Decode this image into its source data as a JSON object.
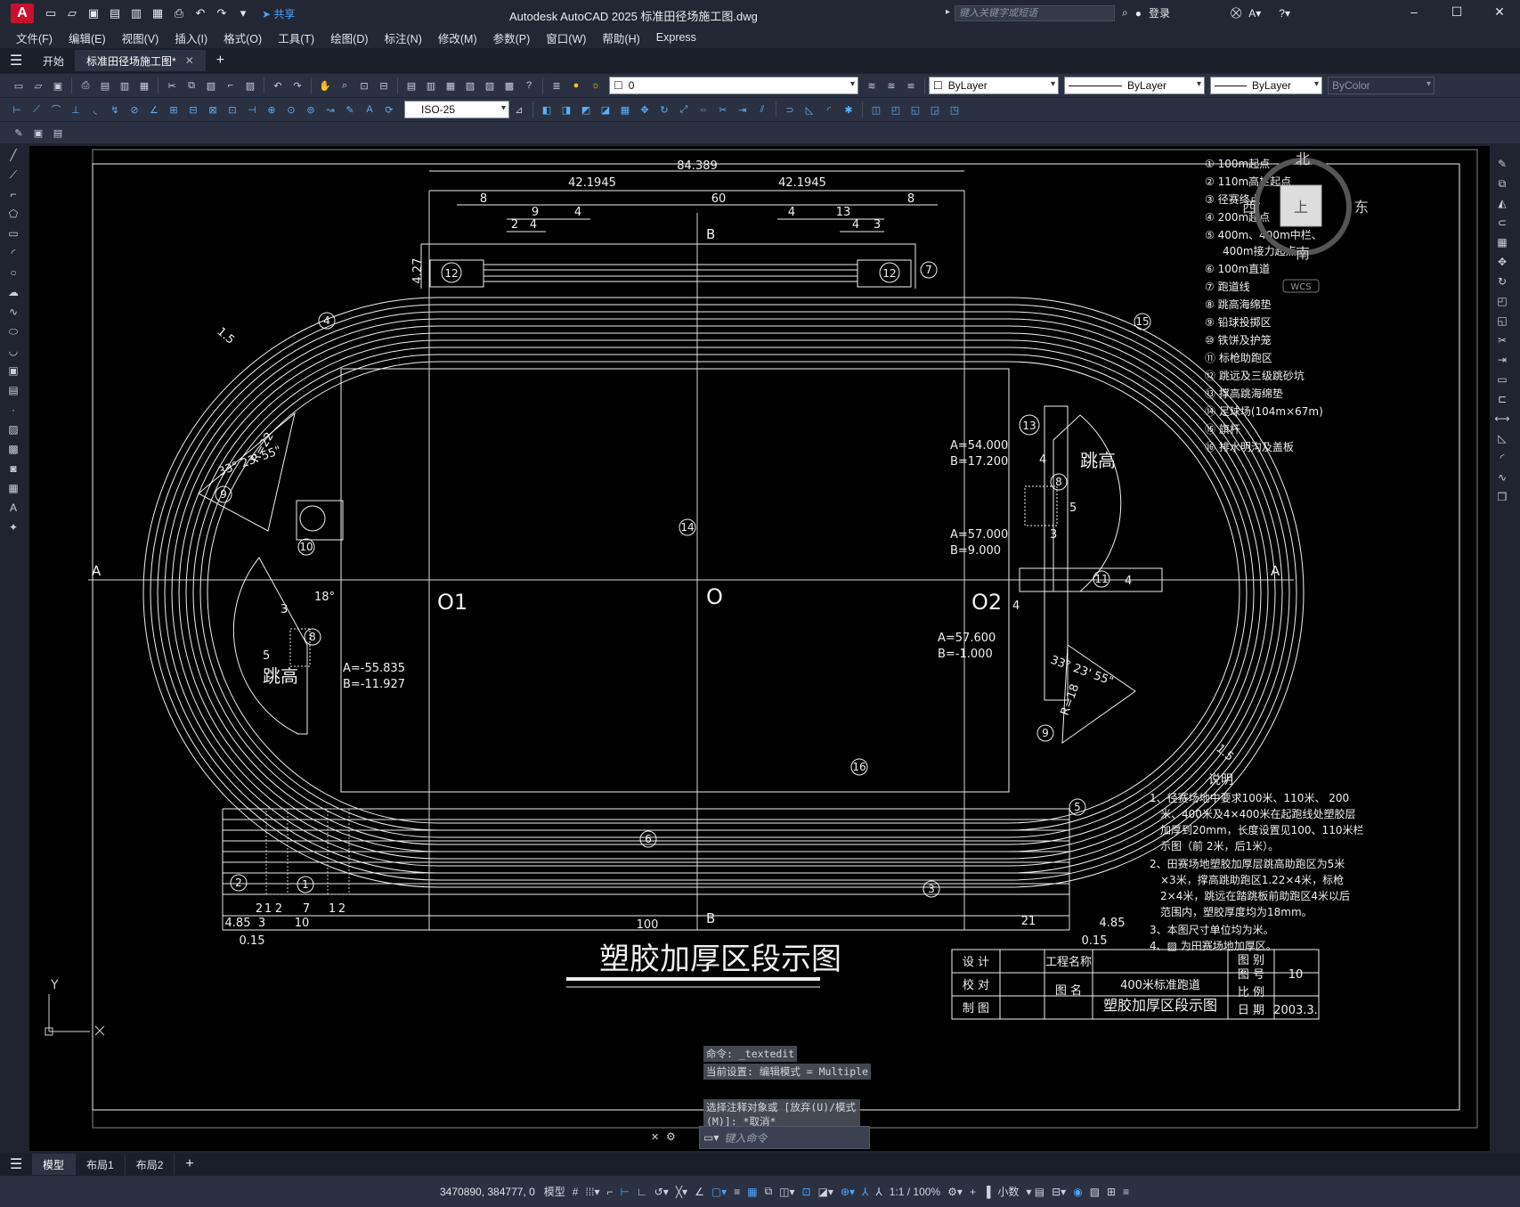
{
  "app": {
    "logo_letter": "A",
    "share_label": "共享",
    "window_title": "Autodesk AutoCAD 2025    标准田径场施工图.dwg",
    "search_placeholder": "键入关键字或短语",
    "login_label": "登录"
  },
  "menus": [
    "文件(F)",
    "编辑(E)",
    "视图(V)",
    "插入(I)",
    "格式(O)",
    "工具(T)",
    "绘图(D)",
    "标注(N)",
    "修改(M)",
    "参数(P)",
    "窗口(W)",
    "帮助(H)",
    "Express"
  ],
  "tabs": [
    {
      "label": "开始"
    },
    {
      "label": "标准田径场施工图*"
    }
  ],
  "toolbar": {
    "layer_value": "0",
    "color_value": "ByLayer",
    "linetype_value": "ByLayer",
    "lineweight_value": "ByLayer",
    "plotstyle_value": "ByColor",
    "dimstyle_value": "ISO-25"
  },
  "drawing": {
    "title": "塑胶加厚区段示图",
    "dims": {
      "total": "84.389",
      "half_left": "42.1945",
      "half_right": "42.1945",
      "d60": "60",
      "d8a": "8",
      "d8b": "8",
      "d9": "9",
      "d4a": "4",
      "d2": "2",
      "d4b": "4",
      "d4c": "4",
      "d13": "13",
      "d4d": "4",
      "d3": "3",
      "d427": "4.27",
      "d15a": "1.5",
      "d15b": "1.5",
      "b100": "100",
      "b21": "21",
      "b485a": "4.85",
      "b015a": "0.15",
      "b485b": "4.85",
      "b015b": "0.15",
      "b2a": "2",
      "b1a": "1",
      "b2b": "2",
      "b7": "7",
      "b1b": "1",
      "b2c": "2",
      "b3": "3",
      "b10": "10"
    },
    "labels": {
      "B_top": "B",
      "B_bottom": "B",
      "A_left": "A",
      "A_right": "A",
      "O1": "O1",
      "O": "O",
      "O2": "O2",
      "jump_left": "跳高",
      "jump_right": "跳高",
      "angle_left": "33° 23' 55\"",
      "angle_right": "33° 23' 55\"",
      "r22": "R=22",
      "r18": "R=18",
      "deg18": "18°",
      "ab1_a": "A=54.000",
      "ab1_b": "B=17.200",
      "ab2_a": "A=57.000",
      "ab2_b": "B=9.000",
      "ab3_a": "A=57.600",
      "ab3_b": "B=-1.000",
      "ab4_a": "A=-55.835",
      "ab4_b": "B=-11.927",
      "d5a": "5",
      "d3b": "3",
      "d4e": "4",
      "d4f": "4",
      "d4g": "4",
      "d3c": "3",
      "d5b": "5"
    },
    "legend": [
      "① 100m起点",
      "② 110m高栏起点",
      "③ 径赛终点",
      "④ 200m起点",
      "⑤ 400m、400m中栏、",
      "400m接力起点",
      "⑥ 100m直道",
      "⑦ 跑道线",
      "⑧ 跳高海绵垫",
      "⑨ 铅球投掷区",
      "⑩ 铁饼及护笼",
      "⑪ 标枪助跑区",
      "⑫ 跳远及三级跳砂坑",
      "⑬ 撑高跳海绵垫",
      "⑭ 足球场(104m×67m)",
      "⑮ 旗杆",
      "⑯ 排水明沟及盖板"
    ],
    "notes_title": "说明",
    "notes": [
      "1、径赛场地中要求100米、110米、  200",
      "米、400米及4×400米在起跑线处塑胶层",
      "加厚到20mm，长度设置见100、110米栏",
      "示图（前 2米，后1米）。",
      "2、田赛场地塑胶加厚层跳高助跑区为5米",
      "×3米，撑高跳助跑区1.22×4米，标枪",
      "2×4米，跳远在踏跳板前助跑区4米以后",
      "范围内，塑胶厚度均为18mm。",
      "3、本图尺寸单位均为米。",
      "4、▨ 为田赛场地加厚区。"
    ],
    "title_block": {
      "design": "设 计",
      "check": "校 对",
      "draw": "制 图",
      "project_name": "工程名称",
      "drawing_name": "图 名",
      "project_value": "400米标准跑道",
      "drawing_value": "塑胶加厚区段示图",
      "sheet_type": "图 别",
      "sheet_no": "图 号",
      "sheet_no_value": "10",
      "scale": "比 例",
      "date": "日 期",
      "date_value": "2003.3."
    },
    "viewcube": {
      "north": "北",
      "south": "南",
      "east": "东",
      "west": "西",
      "top": "上",
      "wcs": "WCS"
    },
    "ucs_y": "Y"
  },
  "command": {
    "history": [
      "命令: _textedit",
      "当前设置: 编辑模式 = Multiple",
      "选择注释对象或 [放弃(U)/模式(M)]: *取消*"
    ],
    "placeholder": "键入命令"
  },
  "layouts": [
    {
      "label": "模型"
    },
    {
      "label": "布局1"
    },
    {
      "label": "布局2"
    }
  ],
  "status": {
    "coords": "3470890, 384777, 0",
    "model": "模型",
    "scale": "1:1 / 100%",
    "units": "小数"
  }
}
